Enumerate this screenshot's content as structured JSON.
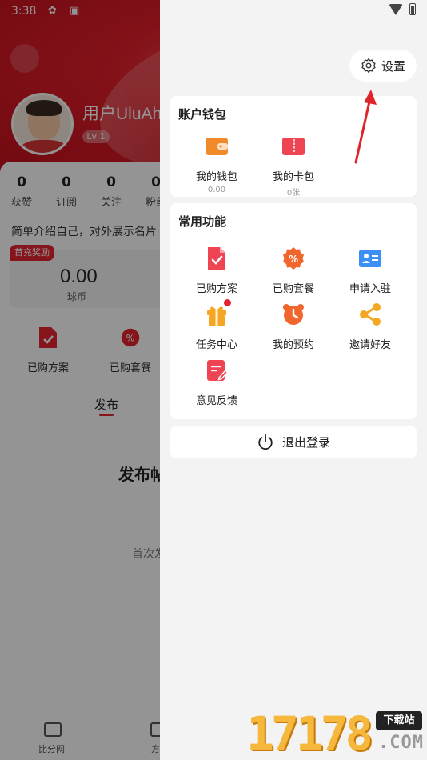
{
  "status_bar": {
    "time": "3:38"
  },
  "background": {
    "username": "用户UluAh",
    "level": "Lv 1",
    "stats": [
      {
        "value": "0",
        "label": "获赞"
      },
      {
        "value": "0",
        "label": "订阅"
      },
      {
        "value": "0",
        "label": "关注"
      },
      {
        "value": "0",
        "label": "粉丝"
      }
    ],
    "intro": "简单介绍自己，对外展示名片",
    "badge": "首充奖励",
    "coin_value": "0.00",
    "coin_label": "球币",
    "functions": [
      "已购方案",
      "已购套餐"
    ],
    "tab": "发布",
    "publish_title": "发布帖子",
    "publish_sub": "首次发布",
    "nav": [
      "比分网",
      "方案"
    ]
  },
  "drawer": {
    "settings_label": "设置",
    "wallet": {
      "title": "账户钱包",
      "items": [
        {
          "label": "我的钱包",
          "value": "0.00",
          "icon": "wallet-icon"
        },
        {
          "label": "我的卡包",
          "value": "0张",
          "icon": "card-pack-icon"
        }
      ]
    },
    "common": {
      "title": "常用功能",
      "items": [
        {
          "label": "已购方案",
          "icon": "purchased-plan-icon"
        },
        {
          "label": "已购套餐",
          "icon": "purchased-package-icon"
        },
        {
          "label": "申请入驻",
          "icon": "apply-join-icon"
        },
        {
          "label": "任务中心",
          "icon": "gift-icon"
        },
        {
          "label": "我的预约",
          "icon": "alarm-clock-icon"
        },
        {
          "label": "邀请好友",
          "icon": "share-icon"
        },
        {
          "label": "意见反馈",
          "icon": "feedback-icon"
        }
      ]
    },
    "logout_label": "退出登录"
  },
  "watermark": {
    "digits": "17178",
    "tag": "下载站",
    "domain": ".COM"
  },
  "colors": {
    "accent": "#e5232f",
    "orange": "#f08a2c",
    "blue": "#3b8ff5"
  }
}
